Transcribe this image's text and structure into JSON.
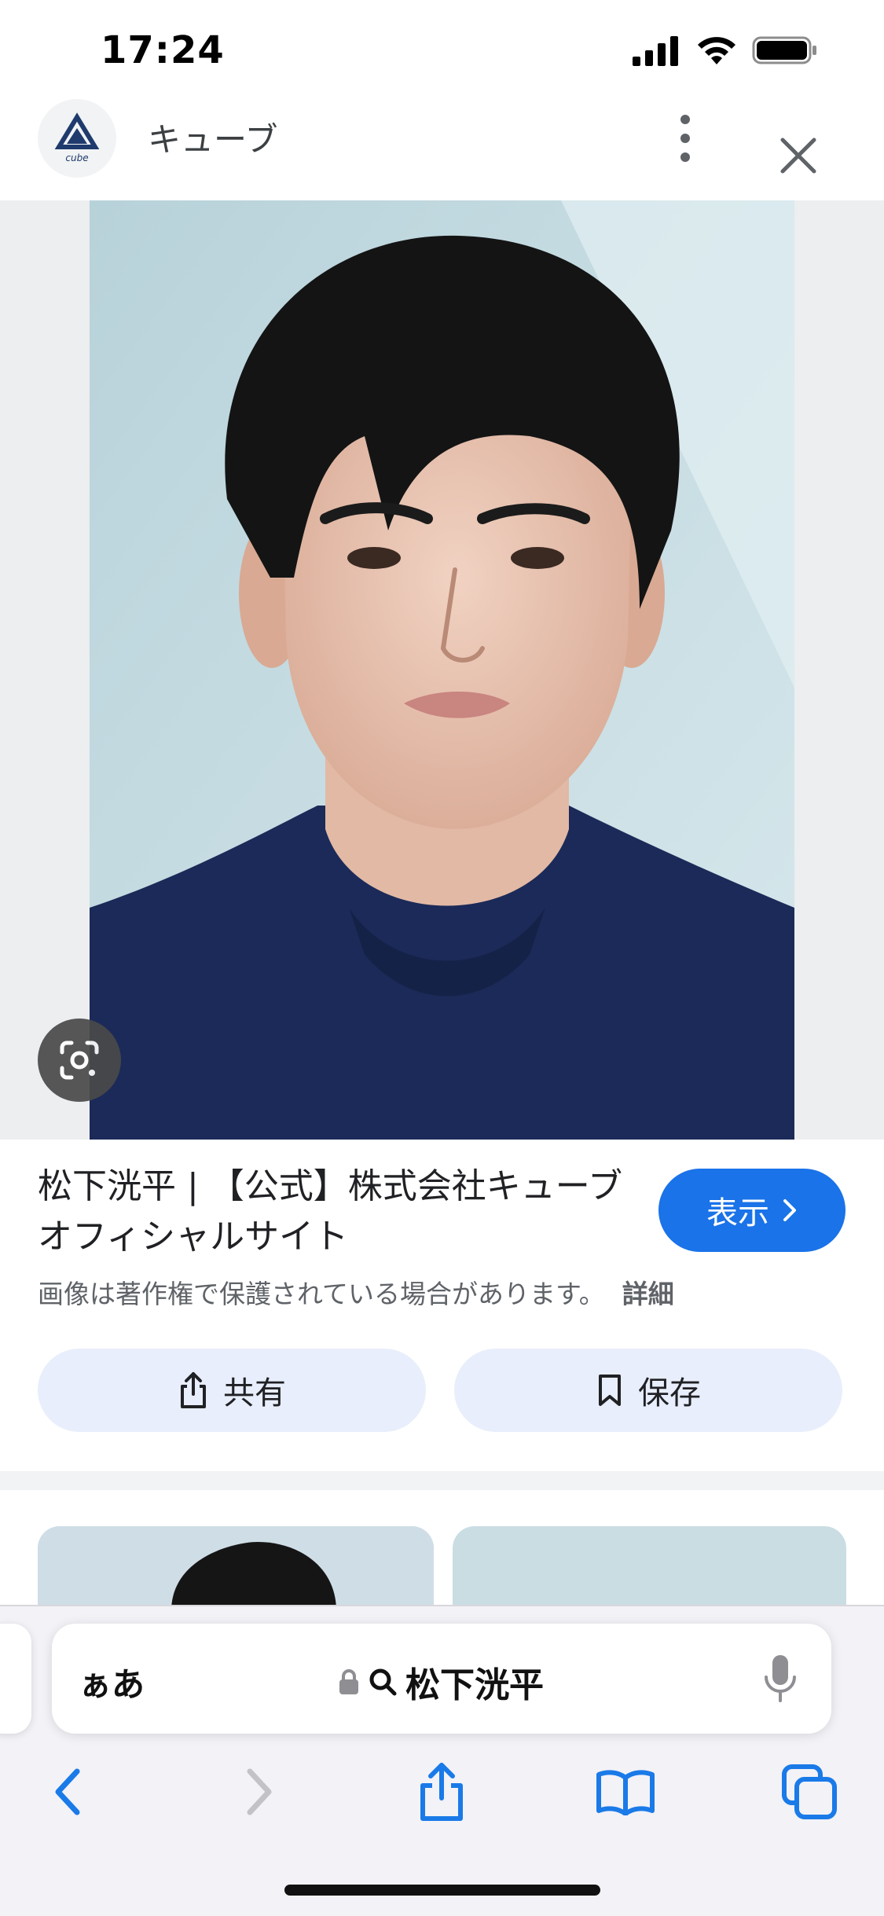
{
  "status": {
    "time": "17:24"
  },
  "header": {
    "site_name": "キューブ",
    "logo_text": "cube"
  },
  "result": {
    "title": "松下洸平 | 【公式】株式会社キューブ オフィシャルサイト",
    "visit_label": "表示",
    "copyright_notice": "画像は著作権で保護されている場合があります。",
    "details_link": "詳細",
    "share_label": "共有",
    "save_label": "保存"
  },
  "browser": {
    "aa_label": "ぁあ",
    "address_text": "松下洸平"
  },
  "colors": {
    "accent": "#1a73e8",
    "action_bg": "#e8eefb",
    "safari_blue": "#1a7ae8"
  }
}
